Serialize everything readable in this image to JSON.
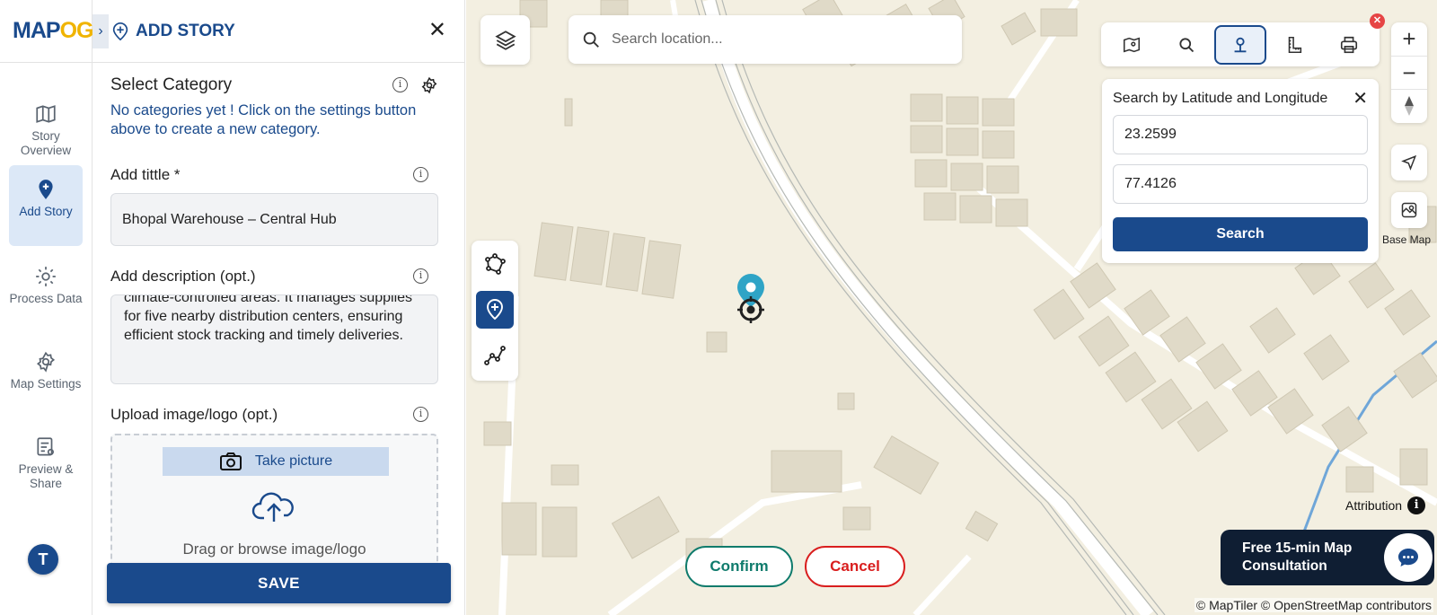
{
  "brand": {
    "logo_text_main": "MAP",
    "logo_text_accent": "OG"
  },
  "nav": {
    "items": [
      {
        "label": "Story Overview",
        "icon": "map-icon",
        "active": false
      },
      {
        "label": "Add Story",
        "icon": "pin-plus-icon",
        "active": true
      },
      {
        "label": "Process Data",
        "icon": "process-gear-icon",
        "active": false
      },
      {
        "label": "Map Settings",
        "icon": "settings-gear-icon",
        "active": false
      },
      {
        "label": "Preview & Share",
        "icon": "preview-icon",
        "active": false
      }
    ],
    "avatar_initial": "T"
  },
  "panel": {
    "title": "ADD STORY",
    "category_label": "Select Category",
    "category_hint": "No categories yet ! Click on the settings button above to create a new category.",
    "title_label": "Add tittle *",
    "title_value": "Bhopal Warehouse – Central Hub",
    "description_label": "Add description (opt.)",
    "description_value": "climate-controlled areas. It manages supplies for five nearby distribution centers, ensuring efficient stock tracking and timely deliveries.",
    "upload_label": "Upload image/logo (opt.)",
    "take_picture_label": "Take picture",
    "upload_hint": "Drag or browse image/logo",
    "save_label": "SAVE"
  },
  "map": {
    "search_placeholder": "Search location...",
    "latlng_panel": {
      "title": "Search by Latitude and Longitude",
      "latitude": "23.2599",
      "longitude": "77.4126",
      "search_label": "Search"
    },
    "toolbar_icons": [
      "map-legend-icon",
      "search-icon",
      "lat-lng-pin-icon",
      "measure-icon",
      "print-icon"
    ],
    "zoom_in": "+",
    "zoom_out": "−",
    "base_map_label": "Base Map",
    "confirm_label": "Confirm",
    "cancel_label": "Cancel",
    "attribution_label": "Attribution",
    "consult_line1": "Free 15-min Map",
    "consult_line2": "Consultation",
    "copyright": "© MapTiler © OpenStreetMap contributors"
  },
  "colors": {
    "primary": "#1a4a8c",
    "confirm": "#0f7b6c",
    "cancel": "#d91e1e",
    "map_bg": "#f3efe1",
    "building": "#e0dac8"
  }
}
